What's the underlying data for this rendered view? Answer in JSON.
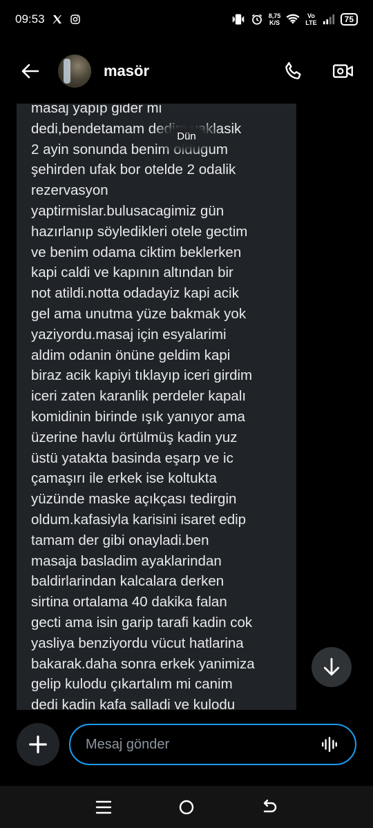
{
  "status_bar": {
    "time": "09:53",
    "net_speed_value": "8,75",
    "net_speed_unit": "K/S",
    "network_line1": "Vo",
    "network_line2": "LTE",
    "battery": "75",
    "icons": [
      "x-logo-icon",
      "instagram-icon",
      "vibrate-icon",
      "alarm-icon",
      "wifi-icon",
      "signal-icon"
    ]
  },
  "header": {
    "contact_name": "masör",
    "actions": [
      "phone-icon",
      "video-call-icon"
    ]
  },
  "chat": {
    "date_separator": "Dün",
    "message_lines": [
      "masaj yapıp gider mi",
      "dedi,bendetamam dedim yaklasik",
      "2 ayin sonunda benim oldugum",
      "şehirden ufak bor otelde 2 odalik",
      "rezervasyon",
      "yaptirmislar.bulusacagimiz gün",
      "hazırlanıp söyledikleri otele gectim",
      "ve benim odama ciktim beklerken",
      "kapi caldi ve kapının altından bir",
      "not atildi.notta odadayiz kapi acik",
      "gel ama unutma yüze bakmak yok",
      "yaziyordu.masaj için esyalarimi",
      "aldim odanin önüne geldim kapi",
      "biraz acik kapiyi tıklayıp iceri girdim",
      "iceri zaten karanlik perdeler kapalı",
      "komidinin birinde ışık yanıyor ama",
      "üzerine havlu örtülmüş kadin yuz",
      "üstü yatakta basinda eşarp ve ic",
      "çamaşırı ile erkek ise koltukta",
      "yüzünde maske  açıkçası tedirgin",
      "oldum.kafasiyla karisini isaret edip",
      "tamam der gibi onayladi.ben",
      "masaja basladim ayaklarindan",
      "baldirlarindan kalcalara derken",
      "sirtina ortalama 40 dakika falan",
      "gecti ama isin garip tarafi kadin cok",
      "yasliya benziyordu vücut hatlarina",
      "bakarak.daha sonra erkek yanimiza",
      "gelip kulodu çıkartalım mi canim",
      "dedi kadin kafa salladi ve kulodu"
    ]
  },
  "composer": {
    "placeholder": "Mesaj gönder"
  },
  "colors": {
    "accent": "#1d9bf0",
    "bubble": "#202327",
    "background": "#000000"
  }
}
